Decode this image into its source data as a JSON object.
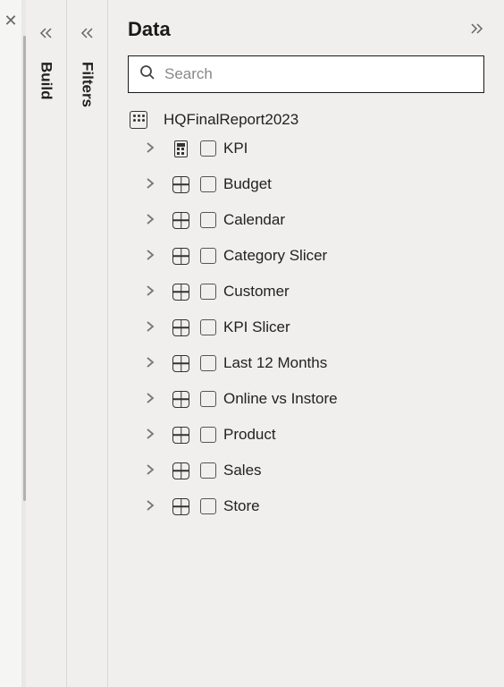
{
  "panes": {
    "build_label": "Build",
    "filters_label": "Filters"
  },
  "data_pane": {
    "title": "Data",
    "search_placeholder": "Search",
    "dataset": {
      "name": "HQFinalReport2023",
      "tables": [
        {
          "name": "KPI",
          "icon_type": "calc",
          "checked": false
        },
        {
          "name": "Budget",
          "icon_type": "table",
          "checked": false
        },
        {
          "name": "Calendar",
          "icon_type": "table",
          "checked": false
        },
        {
          "name": "Category Slicer",
          "icon_type": "table",
          "checked": false
        },
        {
          "name": "Customer",
          "icon_type": "table",
          "checked": false
        },
        {
          "name": "KPI Slicer",
          "icon_type": "table",
          "checked": false
        },
        {
          "name": "Last 12 Months",
          "icon_type": "table",
          "checked": false
        },
        {
          "name": "Online vs Instore",
          "icon_type": "table",
          "checked": false
        },
        {
          "name": "Product",
          "icon_type": "table",
          "checked": false
        },
        {
          "name": "Sales",
          "icon_type": "table",
          "checked": false
        },
        {
          "name": "Store",
          "icon_type": "table",
          "checked": false
        }
      ]
    }
  }
}
